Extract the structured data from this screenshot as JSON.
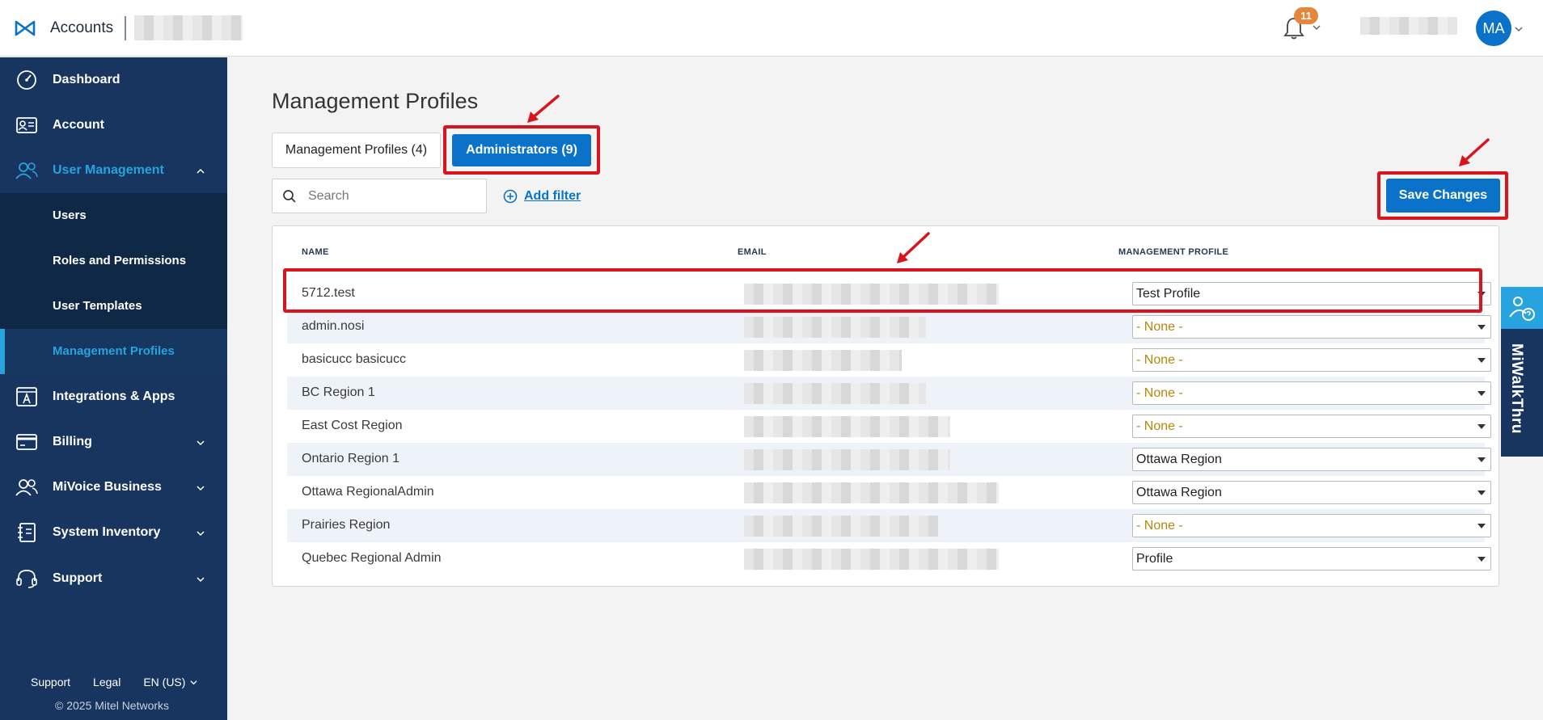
{
  "header": {
    "app_title": "Accounts",
    "notification_count": "11",
    "avatar_initials": "MA"
  },
  "sidebar": {
    "items": [
      {
        "label": "Dashboard",
        "icon": "dashboard-gauge-icon"
      },
      {
        "label": "Account",
        "icon": "id-card-icon"
      },
      {
        "label": "User Management",
        "icon": "users-icon",
        "expanded": true,
        "active": true
      },
      {
        "label": "Integrations & Apps",
        "icon": "app-store-icon"
      },
      {
        "label": "Billing",
        "icon": "credit-card-icon"
      },
      {
        "label": "MiVoice Business",
        "icon": "users-icon"
      },
      {
        "label": "System Inventory",
        "icon": "inventory-icon"
      },
      {
        "label": "Support",
        "icon": "headset-icon"
      }
    ],
    "submenu": [
      {
        "label": "Users"
      },
      {
        "label": "Roles and Permissions"
      },
      {
        "label": "User Templates"
      },
      {
        "label": "Management Profiles",
        "active": true
      }
    ],
    "footer": {
      "support": "Support",
      "legal": "Legal",
      "language": "EN (US)",
      "copyright": "© 2025 Mitel Networks"
    }
  },
  "main": {
    "title": "Management Profiles",
    "tabs": [
      {
        "label": "Management Profiles (4)",
        "active": false
      },
      {
        "label": "Administrators (9)",
        "active": true
      }
    ],
    "search": {
      "placeholder": "Search"
    },
    "add_filter": "Add filter",
    "save_label": "Save Changes",
    "table": {
      "columns": [
        "NAME",
        "EMAIL",
        "MANAGEMENT PROFILE"
      ],
      "rows": [
        {
          "name": "5712.test",
          "profile": "Test Profile"
        },
        {
          "name": "admin.nosi",
          "profile": "- None -"
        },
        {
          "name": "basicucc basicucc",
          "profile": "- None -"
        },
        {
          "name": "BC Region 1",
          "profile": "- None -"
        },
        {
          "name": "East Cost Region",
          "profile": "- None -"
        },
        {
          "name": "Ontario Region 1",
          "profile": "Ottawa Region"
        },
        {
          "name": "Ottawa RegionalAdmin",
          "profile": "Ottawa Region"
        },
        {
          "name": "Prairies Region",
          "profile": "- None -"
        },
        {
          "name": "Quebec Regional Admin",
          "profile": "Profile"
        }
      ]
    }
  },
  "walkthru": {
    "label": "MiWalkThru"
  },
  "colors": {
    "sidebar": "#17355f",
    "accent": "#0a73c9",
    "annotation_red": "#d9141c",
    "badge": "#e8853d",
    "none_text": "#b8860b"
  }
}
